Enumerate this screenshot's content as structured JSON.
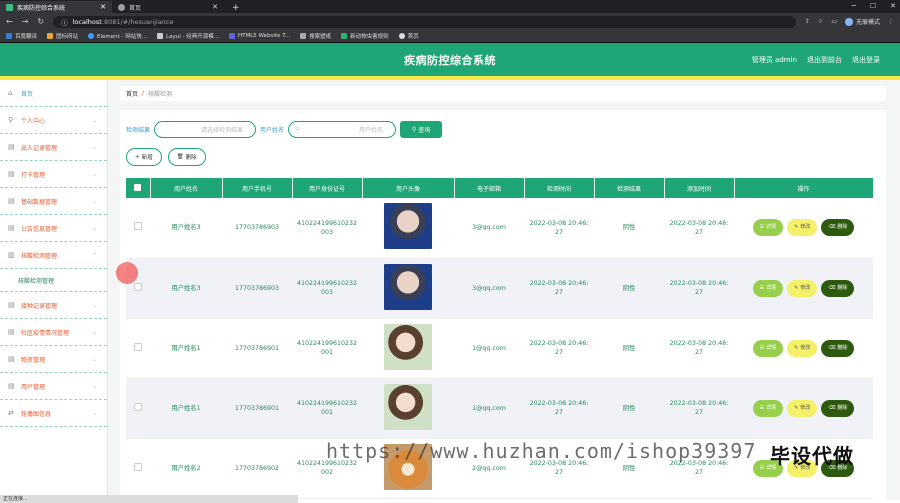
{
  "browser": {
    "tabs": [
      {
        "label": "疾病防控综合系统",
        "active": true
      },
      {
        "label": "首页",
        "active": false
      }
    ],
    "url_host": "localhost",
    "url_path": ":8081/#/hesuanjiance",
    "profile": "无痕模式",
    "bookmarks": [
      "百度翻译",
      "图标网站",
      "Element - 网站快...",
      "Layui - 经典开源模...",
      "HTML5 Website T...",
      "搜索壁纸",
      "新动物虫害规则",
      "首页"
    ]
  },
  "header": {
    "title": "疾病防控综合系统",
    "user": "管理员 admin",
    "front_link": "退出到前台",
    "logout": "退出登录"
  },
  "sidebar": {
    "items": [
      {
        "label": "首页",
        "icon": "home-icon"
      },
      {
        "label": "个人中心",
        "icon": "user-icon"
      },
      {
        "label": "出入记录管理",
        "icon": "doc-icon"
      },
      {
        "label": "打卡管理",
        "icon": "doc-icon"
      },
      {
        "label": "基础数据管理",
        "icon": "doc-icon"
      },
      {
        "label": "公告信息管理",
        "icon": "doc-icon"
      },
      {
        "label": "核酸检测管理",
        "icon": "chart-icon"
      }
    ],
    "sub": "核酸检测管理",
    "items2": [
      {
        "label": "接种记录管理",
        "icon": "doc-icon"
      },
      {
        "label": "社区疫情情况管理",
        "icon": "doc-icon"
      },
      {
        "label": "物资管理",
        "icon": "doc-icon"
      },
      {
        "label": "用户管理",
        "icon": "doc-icon"
      },
      {
        "label": "轮播图信息",
        "icon": "swap-icon"
      }
    ]
  },
  "breadcrumb": {
    "home": "首页",
    "sep": "/",
    "current": "核酸检测"
  },
  "search": {
    "label1": "检测结果",
    "placeholder1": "请选择检测结果",
    "label2": "用户姓名",
    "placeholder2": "用户姓名",
    "button": "查询"
  },
  "actions": {
    "add": "新增",
    "delete": "删除"
  },
  "table": {
    "headers": [
      "用户姓名",
      "用户手机号",
      "用户身份证号",
      "用户头像",
      "电子邮箱",
      "检测时间",
      "检测结果",
      "添加时间",
      "操作"
    ],
    "rows": [
      {
        "name": "用户姓名3",
        "phone": "17703786903",
        "id1": "410224199610232",
        "id2": "003",
        "photo": "boy",
        "email": "3@qq.com",
        "t1": "2022-03-08 20:46:",
        "t2": "27",
        "result": "阴性",
        "a1": "2022-03-08 20:46:",
        "a2": "27"
      },
      {
        "name": "用户姓名3",
        "phone": "17703786903",
        "id1": "410224199610232",
        "id2": "003",
        "photo": "boy",
        "email": "3@qq.com",
        "t1": "2022-03-08 20:46:",
        "t2": "27",
        "result": "阴性",
        "a1": "2022-03-08 20:46:",
        "a2": "27"
      },
      {
        "name": "用户姓名1",
        "phone": "17703786901",
        "id1": "410224199610232",
        "id2": "001",
        "photo": "girl",
        "email": "1@qq.com",
        "t1": "2022-03-08 20:46:",
        "t2": "27",
        "result": "阴性",
        "a1": "2022-03-08 20:46:",
        "a2": "27"
      },
      {
        "name": "用户姓名1",
        "phone": "17703786901",
        "id1": "410224199610232",
        "id2": "001",
        "photo": "girl",
        "email": "1@qq.com",
        "t1": "2022-03-08 20:46:",
        "t2": "27",
        "result": "阴性",
        "a1": "2022-03-08 20:46:",
        "a2": "27"
      },
      {
        "name": "用户姓名2",
        "phone": "17703786902",
        "id1": "410224199610232",
        "id2": "002",
        "photo": "dog",
        "email": "2@qq.com",
        "t1": "2022-03-08 20:46:",
        "t2": "27",
        "result": "阴性",
        "a1": "2022-03-08 20:46:",
        "a2": "27"
      }
    ],
    "ops": {
      "detail": "详情",
      "edit": "修改",
      "delete": "删除"
    }
  },
  "watermark": "https://www.huzhan.com/ishop39397",
  "watermark2": "毕设代做",
  "status": "正在连接..."
}
